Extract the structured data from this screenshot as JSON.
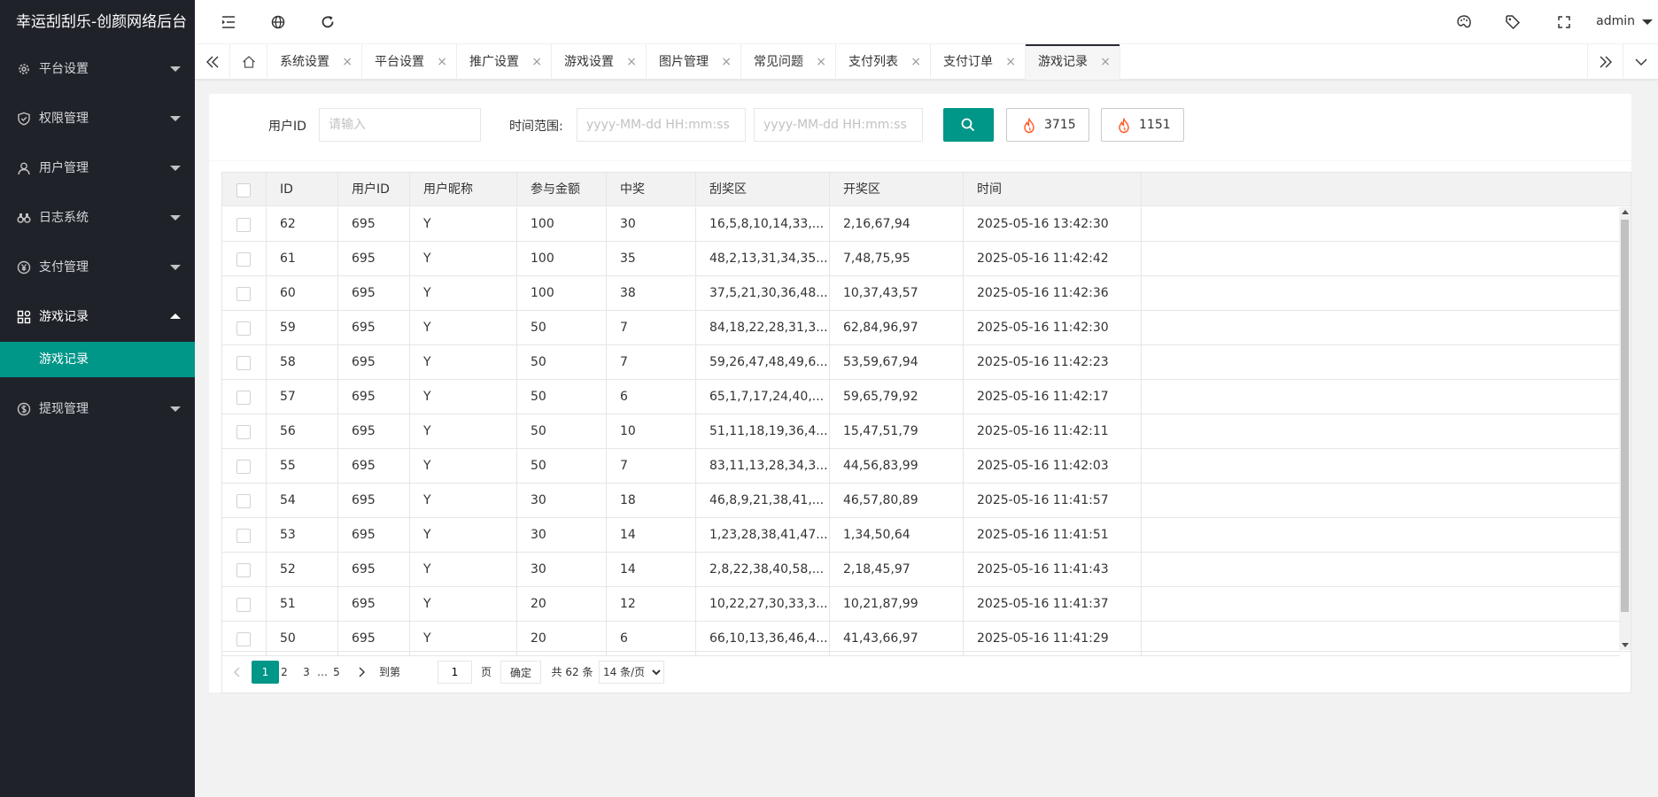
{
  "app": {
    "title": "幸运刮刮乐-创颜网络后台"
  },
  "colors": {
    "accent": "#009688",
    "sidebar_bg": "#20222a",
    "fire": "#ff5722"
  },
  "sidebar": {
    "items": [
      {
        "label": "平台设置",
        "icon": "gear-icon"
      },
      {
        "label": "权限管理",
        "icon": "shield-icon"
      },
      {
        "label": "用户管理",
        "icon": "user-icon"
      },
      {
        "label": "日志系统",
        "icon": "binoculars-icon"
      },
      {
        "label": "支付管理",
        "icon": "yen-icon"
      },
      {
        "label": "游戏记录",
        "icon": "apps-icon"
      },
      {
        "label": "提现管理",
        "icon": "dollar-icon"
      }
    ],
    "active_sub": "游戏记录"
  },
  "header": {
    "icons": [
      "menu-toggle-icon",
      "globe-icon",
      "refresh-icon",
      "palette-icon",
      "tag-icon",
      "fullscreen-icon"
    ],
    "user": "admin"
  },
  "tabs": {
    "items": [
      "系统设置",
      "平台设置",
      "推广设置",
      "游戏设置",
      "图片管理",
      "常见问题",
      "支付列表",
      "支付订单",
      "游戏记录"
    ],
    "active": "游戏记录",
    "close_glyph": "×"
  },
  "filter": {
    "user_id_label": "用户ID",
    "user_id_placeholder": "请输入",
    "time_label": "时间范围:",
    "start_placeholder": "yyyy-MM-dd HH:mm:ss",
    "end_placeholder": "yyyy-MM-dd HH:mm:ss",
    "count1": "3715",
    "count2": "1151"
  },
  "table": {
    "columns": [
      "ID",
      "用户ID",
      "用户昵称",
      "参与金额",
      "中奖",
      "刮奖区",
      "开奖区",
      "时间"
    ],
    "rows": [
      [
        "62",
        "695",
        "Y",
        "100",
        "30",
        "16,5,8,10,14,33,...",
        "2,16,67,94",
        "2025-05-16 13:42:30"
      ],
      [
        "61",
        "695",
        "Y",
        "100",
        "35",
        "48,2,13,31,34,35...",
        "7,48,75,95",
        "2025-05-16 11:42:42"
      ],
      [
        "60",
        "695",
        "Y",
        "100",
        "38",
        "37,5,21,30,36,48...",
        "10,37,43,57",
        "2025-05-16 11:42:36"
      ],
      [
        "59",
        "695",
        "Y",
        "50",
        "7",
        "84,18,22,28,31,3...",
        "62,84,96,97",
        "2025-05-16 11:42:30"
      ],
      [
        "58",
        "695",
        "Y",
        "50",
        "7",
        "59,26,47,48,49,6...",
        "53,59,67,94",
        "2025-05-16 11:42:23"
      ],
      [
        "57",
        "695",
        "Y",
        "50",
        "6",
        "65,1,7,17,24,40,...",
        "59,65,79,92",
        "2025-05-16 11:42:17"
      ],
      [
        "56",
        "695",
        "Y",
        "50",
        "10",
        "51,11,18,19,36,4...",
        "15,47,51,79",
        "2025-05-16 11:42:11"
      ],
      [
        "55",
        "695",
        "Y",
        "50",
        "7",
        "83,11,13,28,34,3...",
        "44,56,83,99",
        "2025-05-16 11:42:03"
      ],
      [
        "54",
        "695",
        "Y",
        "30",
        "18",
        "46,8,9,21,38,41,...",
        "46,57,80,89",
        "2025-05-16 11:41:57"
      ],
      [
        "53",
        "695",
        "Y",
        "30",
        "14",
        "1,23,28,38,41,47...",
        "1,34,50,64",
        "2025-05-16 11:41:51"
      ],
      [
        "52",
        "695",
        "Y",
        "30",
        "14",
        "2,8,22,38,40,58,...",
        "2,18,45,97",
        "2025-05-16 11:41:43"
      ],
      [
        "51",
        "695",
        "Y",
        "20",
        "12",
        "10,22,27,30,33,3...",
        "10,21,87,99",
        "2025-05-16 11:41:37"
      ],
      [
        "50",
        "695",
        "Y",
        "20",
        "6",
        "66,10,13,36,46,4...",
        "41,43,66,97",
        "2025-05-16 11:41:29"
      ]
    ]
  },
  "pagination": {
    "pages": [
      "1",
      "2",
      "3",
      "…",
      "5"
    ],
    "current": "1",
    "goto_label": "到第",
    "goto_value": "1",
    "page_unit": "页",
    "confirm": "确定",
    "total": "共 62 条",
    "per_page": "14 条/页"
  }
}
